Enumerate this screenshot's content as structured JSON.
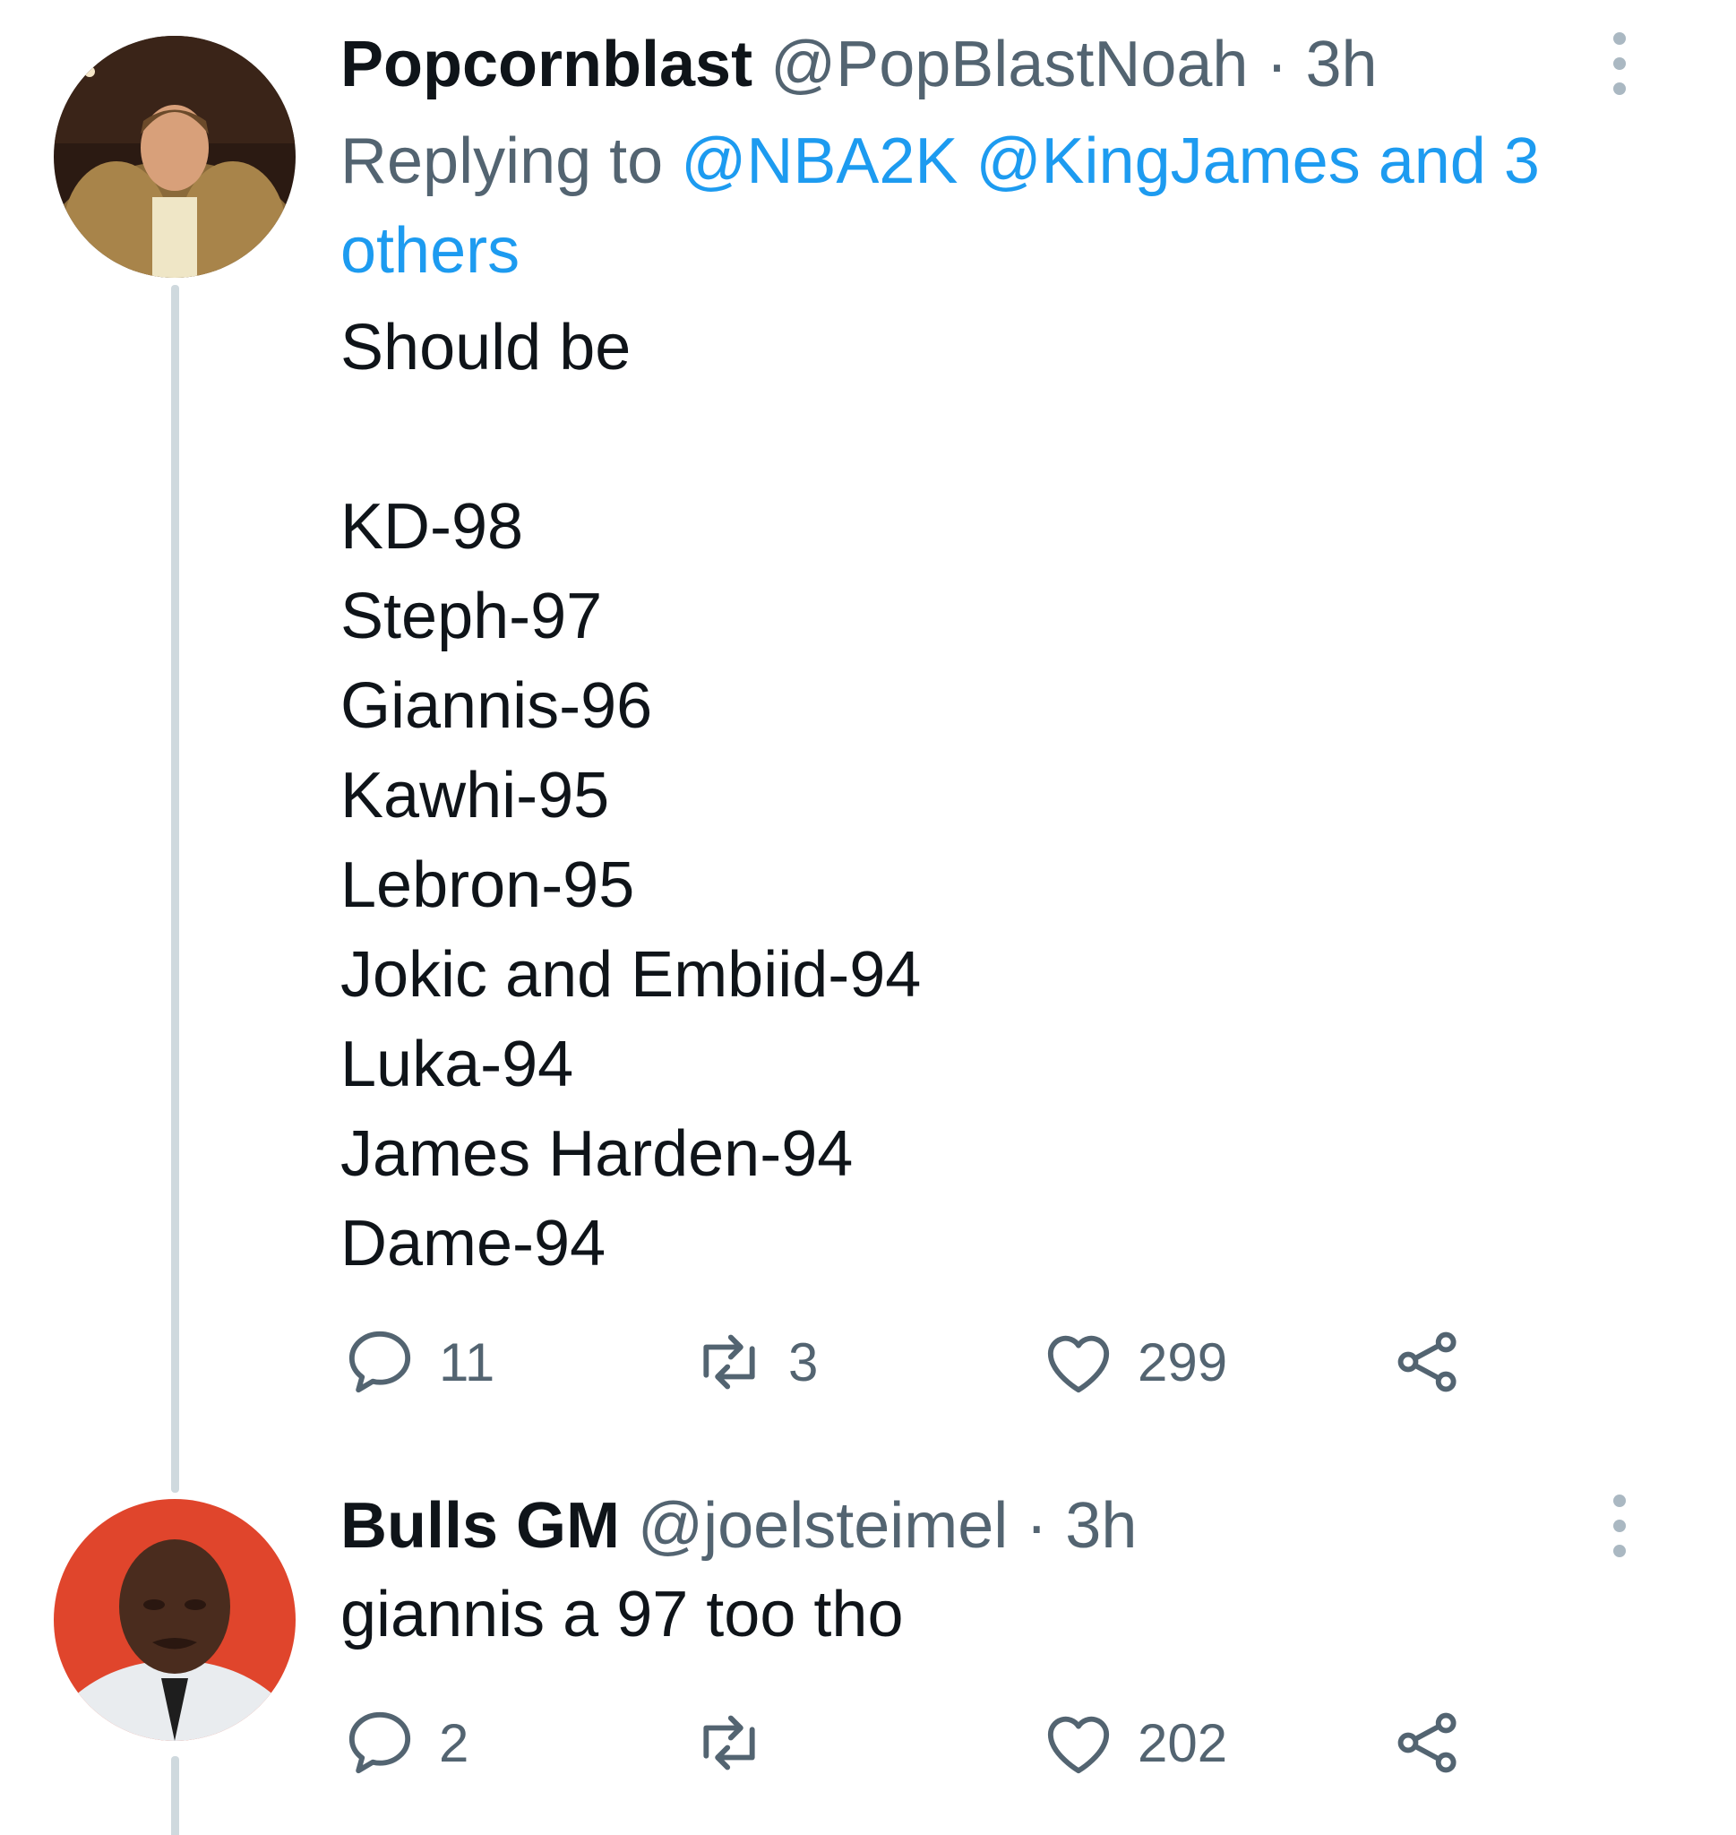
{
  "tweets": [
    {
      "display_name": "Popcornblast",
      "handle": "@PopBlastNoah",
      "separator": "·",
      "time": "3h",
      "replying_prefix": "Replying to",
      "replying_mentions": "@NBA2K @KingJames and 3 others",
      "body_lines": [
        "Should be",
        "",
        "KD-98",
        "Steph-97",
        "Giannis-96",
        "Kawhi-95",
        "Lebron-95",
        "Jokic and Embiid-94",
        "Luka-94",
        "James Harden-94",
        "Dame-94"
      ],
      "replies": "11",
      "retweets": "3",
      "likes": "299"
    },
    {
      "display_name": "Bulls GM",
      "handle": "@joelsteimel",
      "separator": "·",
      "time": "3h",
      "body": "giannis a 97 too tho",
      "replies": "2",
      "retweets": "",
      "likes": "202"
    }
  ],
  "icons": {
    "reply": "reply-icon",
    "retweet": "retweet-icon",
    "like": "heart-icon",
    "share": "share-icon",
    "more": "more-options-icon"
  },
  "colors": {
    "text_primary": "#0f1419",
    "text_secondary": "#536471",
    "link": "#1d9bf0",
    "thread_line": "#cfd9de"
  }
}
